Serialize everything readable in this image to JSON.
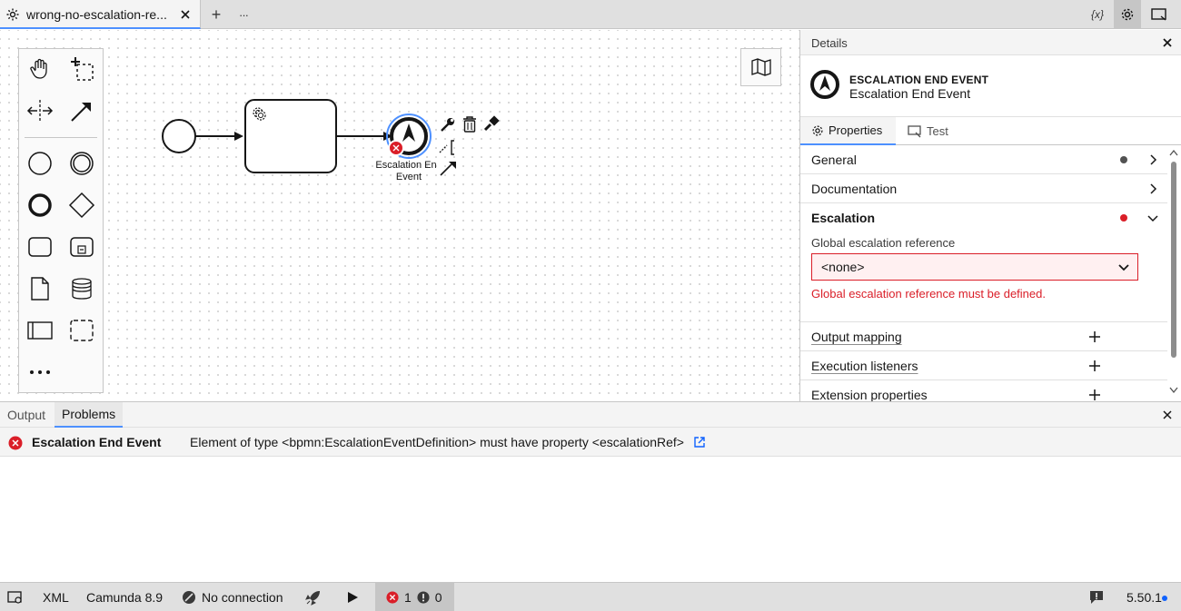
{
  "tabbar": {
    "active_tab": {
      "label": "wrong-no-escalation-re...",
      "icon": "gear-icon"
    },
    "new_tab_label": "+",
    "more_label": "···",
    "variables_label": "{x}"
  },
  "canvas": {
    "palette": [
      "hand-tool",
      "lasso-tool",
      "space-tool",
      "connect-tool",
      "start-event",
      "intermediate-event",
      "end-event",
      "gateway",
      "task",
      "subprocess",
      "data-object",
      "data-store",
      "pool",
      "group",
      "more-tools"
    ],
    "end_event_label": [
      "Escalation En",
      "Event"
    ]
  },
  "details": {
    "header_title": "Details",
    "element_type": "ESCALATION END EVENT",
    "element_name": "Escalation End Event",
    "tabs": [
      {
        "label": "Properties",
        "icon": "gear-icon"
      },
      {
        "label": "Test",
        "icon": "test-icon"
      }
    ],
    "groups": {
      "general": "General",
      "documentation": "Documentation",
      "escalation": "Escalation",
      "output_mapping": "Output mapping",
      "execution_listeners": "Execution listeners",
      "extension_properties": "Extension properties"
    },
    "escalation_field_label": "Global escalation reference",
    "escalation_field_value": "<none>",
    "escalation_field_error": "Global escalation reference must be defined.",
    "colors": {
      "error": "#da1e28",
      "neutral_dot": "#525252",
      "accent": "#4d90ff"
    }
  },
  "bottom_panel": {
    "tabs": [
      "Output",
      "Problems"
    ],
    "active_tab": "Problems",
    "problems": [
      {
        "element": "Escalation End Event",
        "message": "Element of type <bpmn:EscalationEventDefinition> must have property <escalationRef>"
      }
    ]
  },
  "statusbar": {
    "xml_label": "XML",
    "engine_label": "Camunda 8.9",
    "connection_label": "No connection",
    "error_count": "1",
    "warning_count": "0",
    "version": "5.50.1"
  }
}
